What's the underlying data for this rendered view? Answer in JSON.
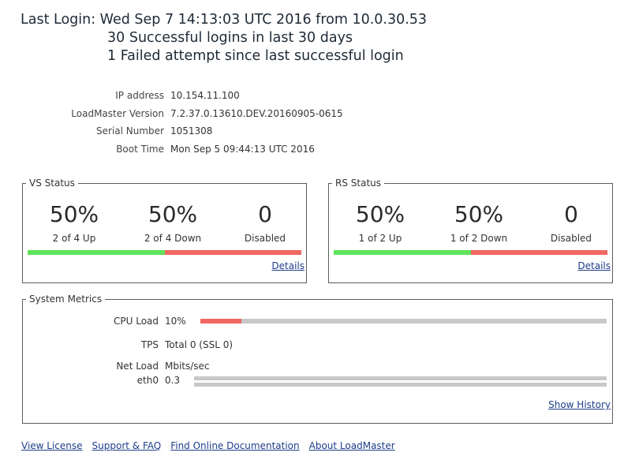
{
  "login": {
    "last_login": "Last Login: Wed Sep 7 14:13:03 UTC 2016 from 10.0.30.53",
    "successful": "30 Successful logins in last 30 days",
    "failed": "1 Failed attempt since last successful login"
  },
  "info": [
    {
      "label": "IP address",
      "value": "10.154.11.100"
    },
    {
      "label": "LoadMaster Version",
      "value": "7.2.37.0.13610.DEV.20160905-0615"
    },
    {
      "label": "Serial Number",
      "value": "1051308"
    },
    {
      "label": "Boot Time",
      "value": "Mon Sep 5 09:44:13 UTC 2016"
    }
  ],
  "vs_status": {
    "title": "VS Status",
    "up_pct": "50%",
    "up_text": "2 of 4 Up",
    "down_pct": "50%",
    "down_text": "2 of 4 Down",
    "disabled_num": "0",
    "disabled_text": "Disabled",
    "up_fraction": 0.5,
    "details_label": "Details"
  },
  "rs_status": {
    "title": "RS Status",
    "up_pct": "50%",
    "up_text": "1 of 2 Up",
    "down_pct": "50%",
    "down_text": "1 of 2 Down",
    "disabled_num": "0",
    "disabled_text": "Disabled",
    "up_fraction": 0.5,
    "details_label": "Details"
  },
  "metrics": {
    "title": "System Metrics",
    "cpu_label": "CPU Load",
    "cpu_value": "10%",
    "cpu_fraction": 0.1,
    "tps_label": "TPS",
    "tps_value": "Total 0 (SSL 0)",
    "net_label": "Net Load",
    "net_unit": "Mbits/sec",
    "eth_label": "eth0",
    "eth_value": "0.3",
    "show_history_label": "Show History"
  },
  "footer": {
    "view_license": "View License",
    "support": "Support & FAQ",
    "docs": "Find Online Documentation",
    "about": "About LoadMaster"
  },
  "colors": {
    "up": "#5fe35a",
    "down": "#f06762",
    "track": "#c8c8c8",
    "link": "#1f3d8a"
  }
}
